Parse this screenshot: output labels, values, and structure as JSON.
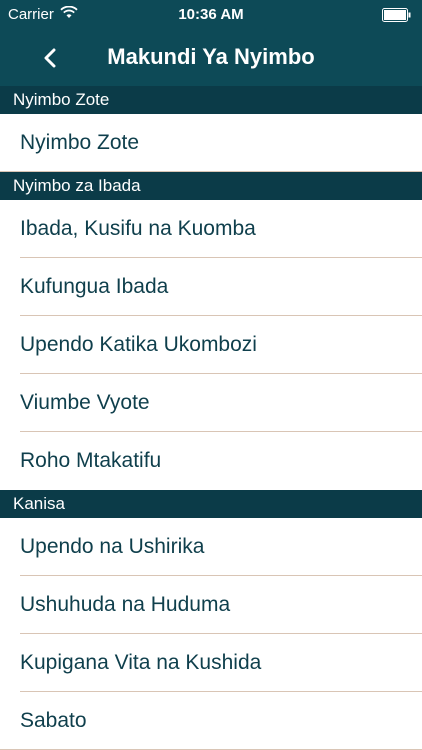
{
  "status_bar": {
    "carrier": "Carrier",
    "time": "10:36 AM",
    "wifi_icon": "wifi-icon",
    "battery_icon": "battery-icon"
  },
  "nav": {
    "back_icon": "chevron-left-icon",
    "title": "Makundi Ya Nyimbo"
  },
  "sections": [
    {
      "header": "Nyimbo Zote",
      "items": [
        "Nyimbo Zote"
      ]
    },
    {
      "header": "Nyimbo za Ibada",
      "items": [
        "Ibada, Kusifu na Kuomba",
        "Kufungua Ibada",
        "Upendo Katika Ukombozi",
        "Viumbe Vyote",
        "Roho Mtakatifu"
      ]
    },
    {
      "header": "Kanisa",
      "items": [
        "Upendo na Ushirika",
        "Ushuhuda na Huduma",
        "Kupigana Vita na Kushida",
        "Sabato"
      ]
    }
  ],
  "colors": {
    "bar": "#0d4a57",
    "section_header": "#0b3b48",
    "row_text": "#0f3f4c",
    "separator": "#d9c5b5"
  }
}
